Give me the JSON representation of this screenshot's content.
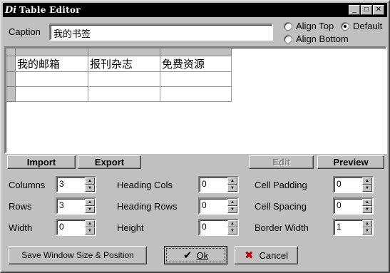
{
  "window": {
    "title": "Table Editor",
    "app_icon": "Di",
    "controls": {
      "minimize": "_",
      "maximize": "□",
      "close": "✕"
    }
  },
  "caption": {
    "label": "Caption",
    "value": "我的书签"
  },
  "align": {
    "options": [
      {
        "label": "Align Top",
        "checked": false
      },
      {
        "label": "Default",
        "checked": true
      },
      {
        "label": "Align Bottom",
        "checked": false
      }
    ]
  },
  "grid": {
    "rows": [
      [
        "我的邮箱",
        "报刊杂志",
        "免费资源"
      ],
      [
        "",
        "",
        ""
      ],
      [
        "",
        "",
        ""
      ]
    ]
  },
  "toolbar": {
    "import_label": "Import",
    "export_label": "Export",
    "edit_label": "Edit",
    "preview_label": "Preview"
  },
  "fields": {
    "columns": {
      "label": "Columns",
      "value": "3"
    },
    "rows": {
      "label": "Rows",
      "value": "3"
    },
    "width": {
      "label": "Width",
      "value": "0"
    },
    "heading_cols": {
      "label": "Heading Cols",
      "value": "0"
    },
    "heading_rows": {
      "label": "Heading Rows",
      "value": "0"
    },
    "height": {
      "label": "Height",
      "value": "0"
    },
    "cell_padding": {
      "label": "Cell Padding",
      "value": "0"
    },
    "cell_spacing": {
      "label": "Cell Spacing",
      "value": "0"
    },
    "border_width": {
      "label": "Border Width",
      "value": "1"
    }
  },
  "footer": {
    "save_label": "Save Window Size & Position",
    "ok_label": "Ok",
    "cancel_label": "Cancel"
  }
}
